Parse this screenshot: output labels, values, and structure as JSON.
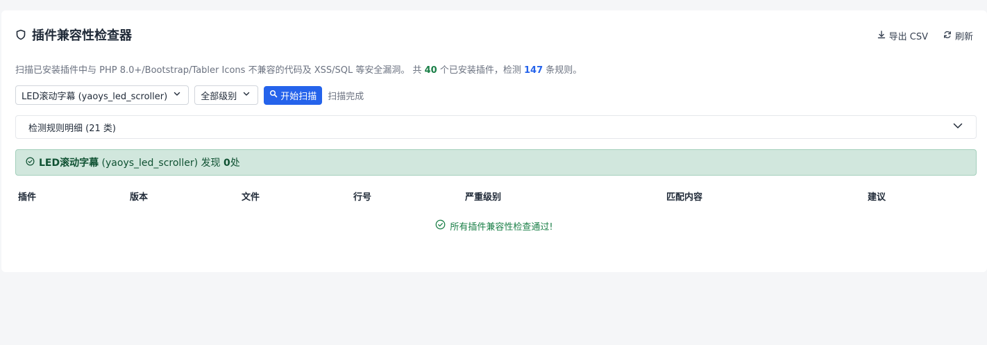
{
  "header": {
    "title": "插件兼容性检查器",
    "export_label": "导出 CSV",
    "refresh_label": "刷新"
  },
  "description": {
    "prefix": "扫描已安装插件中与 PHP 8.0+/Bootstrap/Tabler Icons 不兼容的代码及 XSS/SQL 等安全漏洞。 共 ",
    "plugin_count": "40",
    "middle": " 个已安装插件，检测 ",
    "rule_count": "147",
    "suffix": " 条规则。"
  },
  "controls": {
    "plugin_select": "LED滚动字幕 (yaoys_led_scroller)",
    "level_select": "全部级别",
    "scan_button": "开始扫描",
    "scan_status": "扫描完成"
  },
  "rules_accordion": {
    "label": "检测规则明细 (21 类)"
  },
  "result_alert": {
    "plugin_name": "LED滚动字幕",
    "plugin_id": " (yaoys_led_scroller) 发现 ",
    "count": "0",
    "suffix": "处"
  },
  "table": {
    "columns": [
      "插件",
      "版本",
      "文件",
      "行号",
      "严重级别",
      "匹配内容",
      "建议"
    ],
    "empty_message": "所有插件兼容性检查通过!"
  },
  "colors": {
    "accent": "#2563eb",
    "success": "#1a7f47",
    "alert_bg": "#d1e7dd"
  }
}
